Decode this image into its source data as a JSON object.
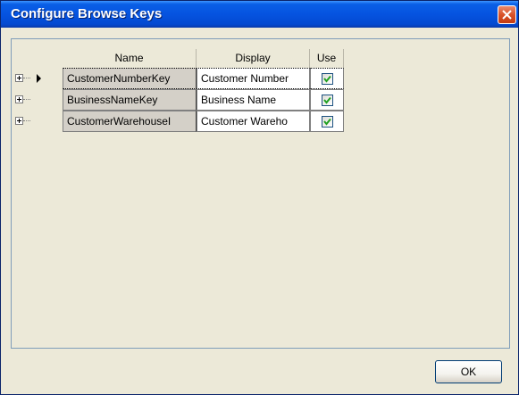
{
  "window": {
    "title": "Configure Browse Keys",
    "close_icon": "close-icon"
  },
  "grid": {
    "columns": [
      "Name",
      "Display",
      "Use"
    ],
    "rows": [
      {
        "name": "CustomerNumberKey",
        "display": "Customer Number",
        "use": true,
        "current": true
      },
      {
        "name": "BusinessNameKey",
        "display": "Business Name",
        "use": true,
        "current": false
      },
      {
        "name": "CustomerWarehouseI",
        "display": "Customer Wareho",
        "use": true,
        "current": false
      }
    ]
  },
  "buttons": {
    "ok_label": "OK"
  },
  "colors": {
    "title_bar": "#0553e0",
    "close_button": "#d9532a",
    "dialog_bg": "#ece9d8",
    "checkmark": "#21a121"
  }
}
